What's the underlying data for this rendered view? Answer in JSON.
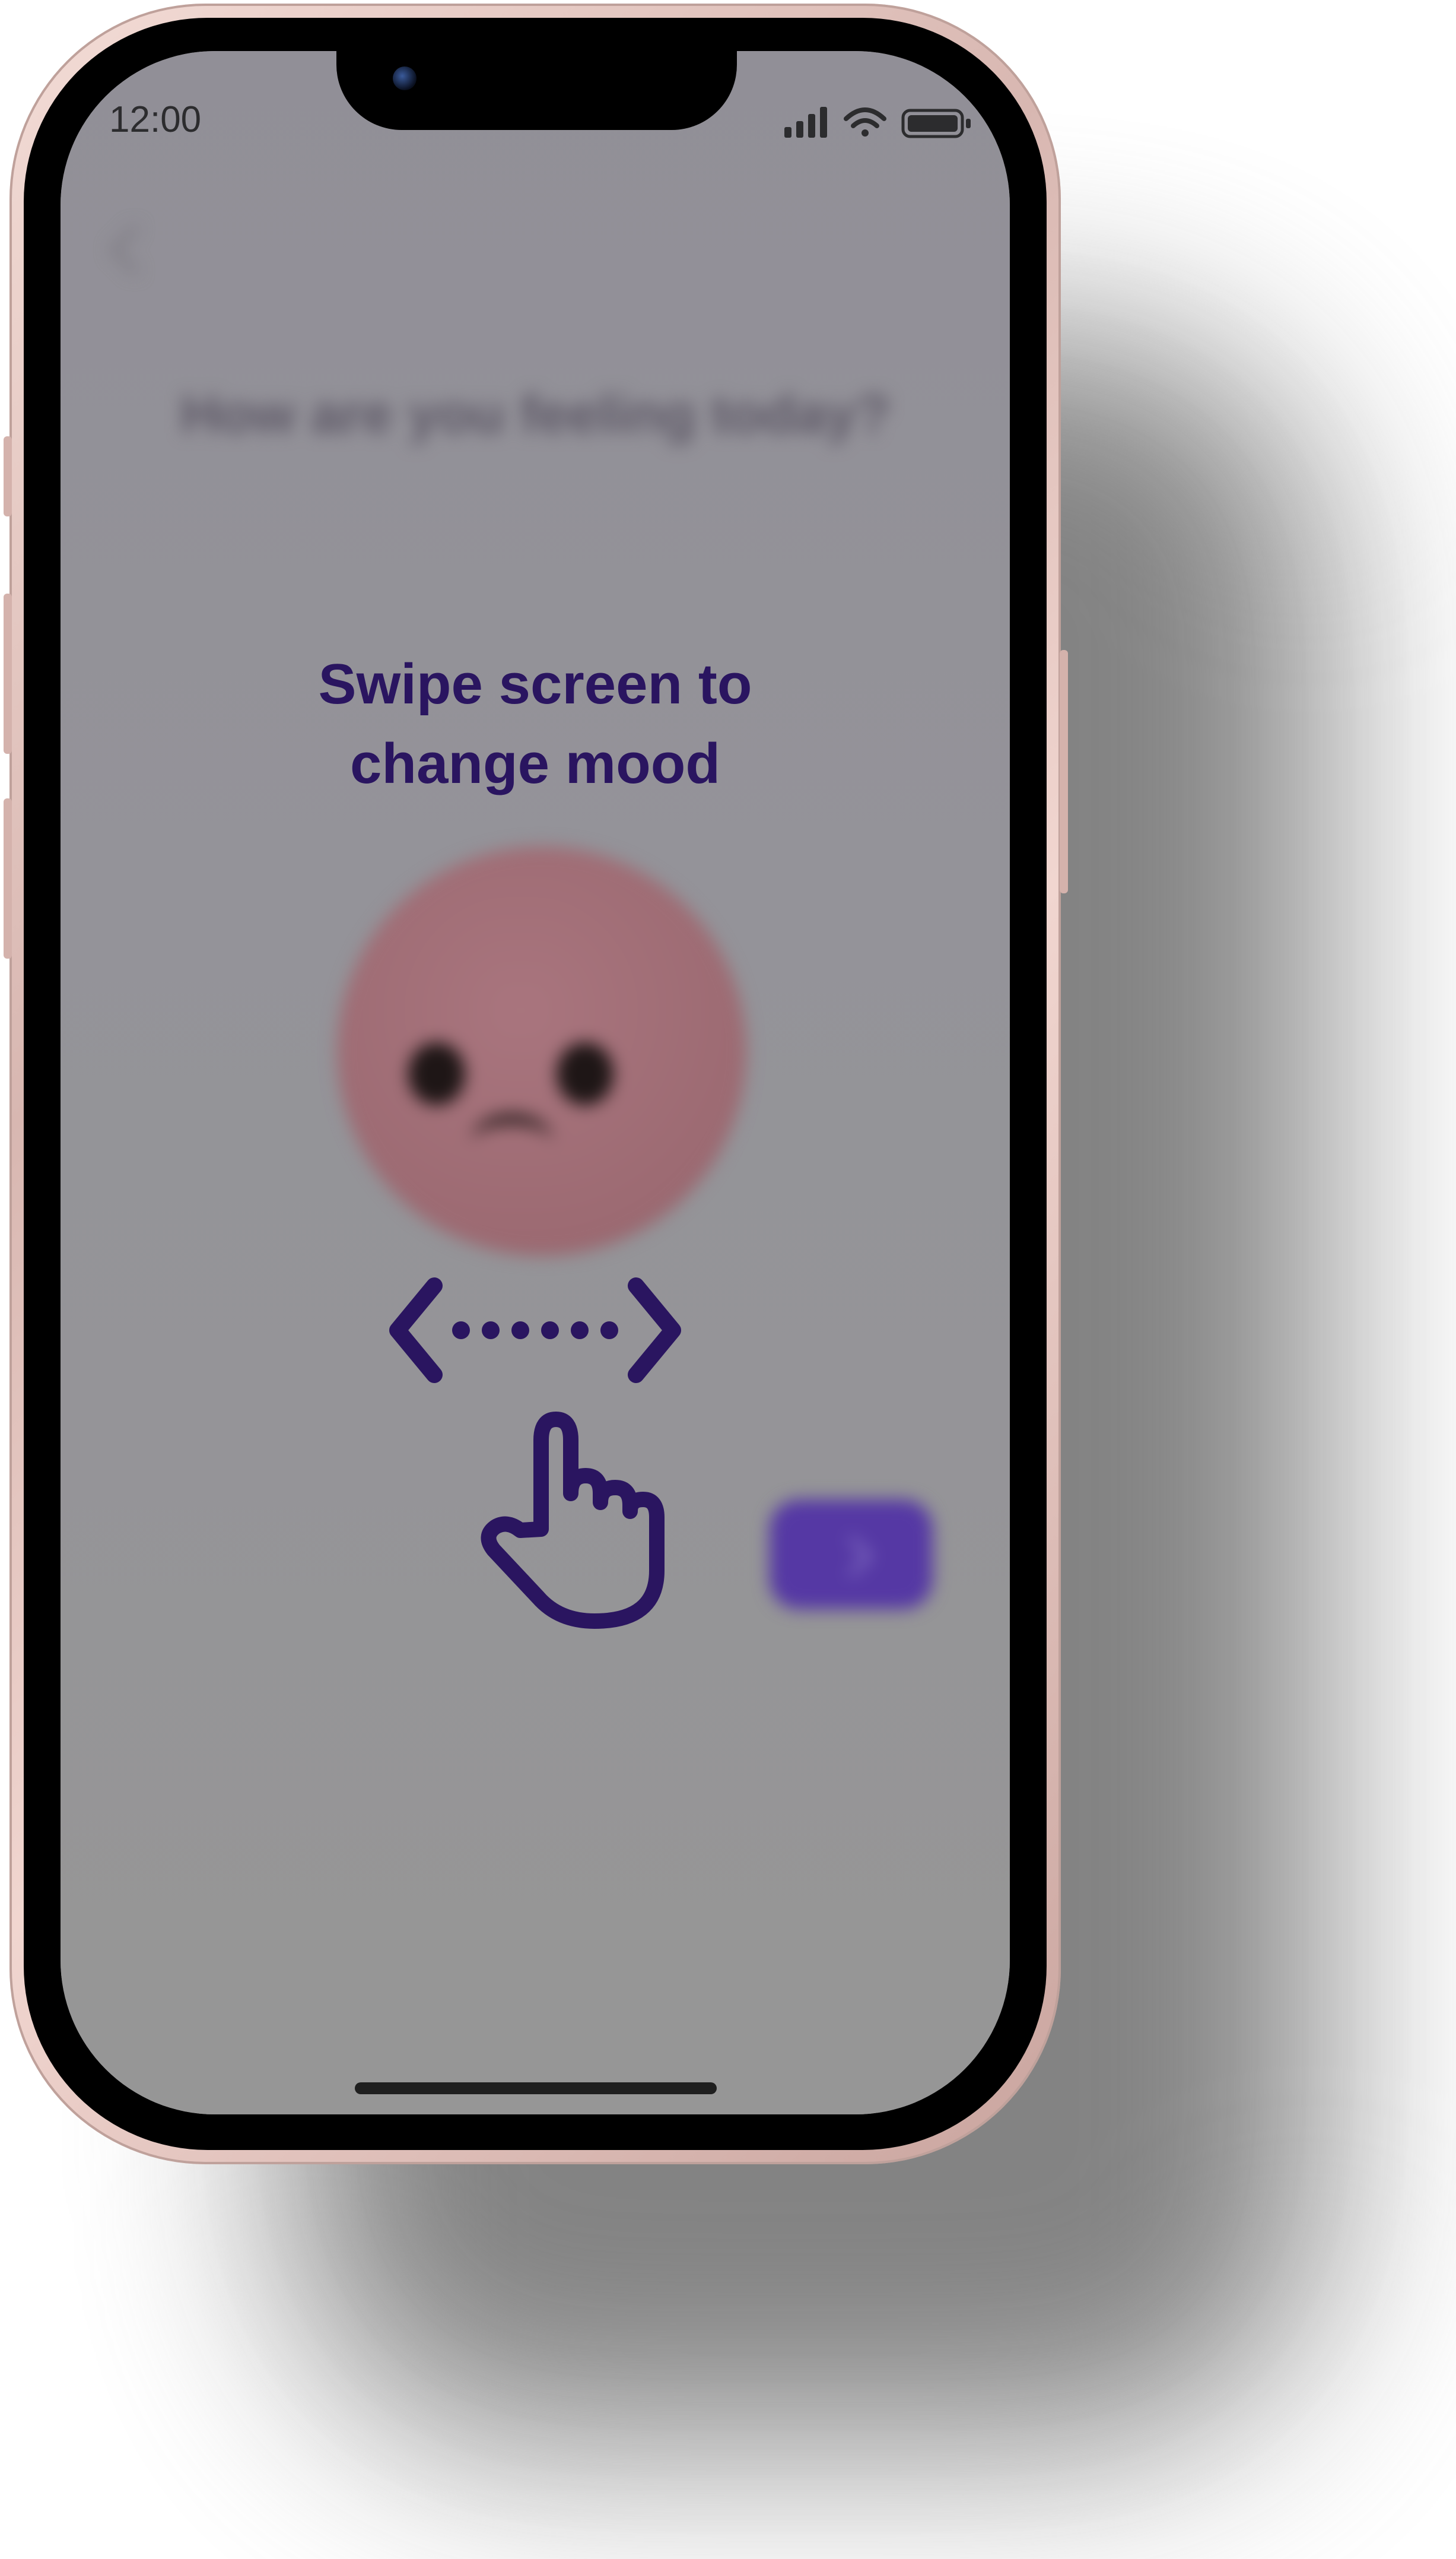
{
  "status_bar": {
    "time": "12:00",
    "icons": [
      "signal-icon",
      "wifi-icon",
      "battery-icon"
    ]
  },
  "header": {
    "back_icon": "chevron-left-icon",
    "title": "How are you feeling today?"
  },
  "overlay": {
    "instruction_line1": "Swipe screen to",
    "instruction_line2": "change mood",
    "swipe_icon": "swipe-arrows-icon",
    "hand_icon": "pointing-hand-icon"
  },
  "mood": {
    "face_icon": "sad-face-icon",
    "face_color": "#a16d76"
  },
  "actions": {
    "next_icon": "arrow-right-icon",
    "next_color": "#5538a4"
  },
  "colors": {
    "accent": "#2a1560",
    "overlay": "#959595"
  }
}
